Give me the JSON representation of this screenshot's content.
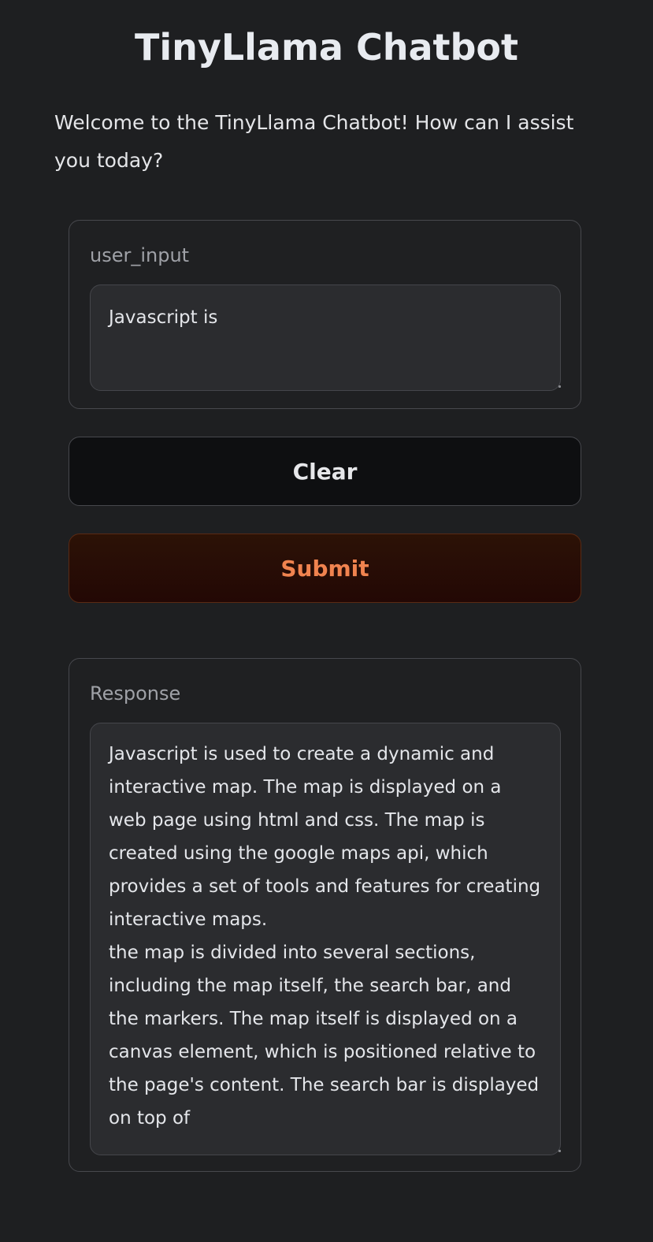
{
  "app": {
    "title": "TinyLlama Chatbot",
    "description": "Welcome to the TinyLlama Chatbot! How can I assist you today?"
  },
  "input": {
    "label": "user_input",
    "value": "Javascript is"
  },
  "buttons": {
    "clear_label": "Clear",
    "submit_label": "Submit"
  },
  "output": {
    "label": "Response",
    "value": "Javascript is used to create a dynamic and interactive map. The map is displayed on a web page using html and css. The map is created using the google maps api, which provides a set of tools and features for creating interactive maps.\nthe map is divided into several sections, including the map itself, the search bar, and the markers. The map itself is displayed on a canvas element, which is positioned relative to the page's content. The search bar is displayed on top of"
  },
  "colors": {
    "background": "#1e1f21",
    "submit_text": "#f0834f",
    "submit_bg": "#230805",
    "clear_bg": "#0e0f11"
  }
}
